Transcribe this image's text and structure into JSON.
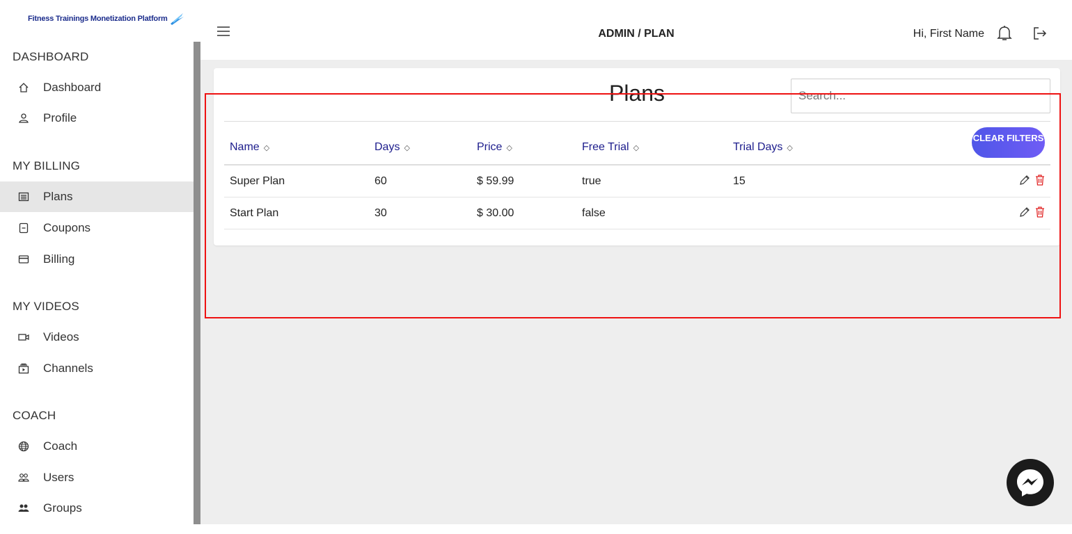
{
  "brand": {
    "name": "Fitness Trainings Monetization Platform"
  },
  "sidebar": {
    "sections": [
      {
        "title": "DASHBOARD",
        "items": [
          {
            "label": "Dashboard",
            "icon": "home-icon"
          },
          {
            "label": "Profile",
            "icon": "user-icon"
          }
        ]
      },
      {
        "title": "MY BILLING",
        "items": [
          {
            "label": "Plans",
            "icon": "list-icon",
            "active": true
          },
          {
            "label": "Coupons",
            "icon": "coupon-icon"
          },
          {
            "label": "Billing",
            "icon": "credit-card-icon"
          }
        ]
      },
      {
        "title": "MY VIDEOS",
        "items": [
          {
            "label": "Videos",
            "icon": "video-icon"
          },
          {
            "label": "Channels",
            "icon": "channels-icon"
          }
        ]
      },
      {
        "title": "COACH",
        "items": [
          {
            "label": "Coach",
            "icon": "globe-icon"
          },
          {
            "label": "Users",
            "icon": "users-icon"
          },
          {
            "label": "Groups",
            "icon": "groups-icon"
          }
        ]
      }
    ]
  },
  "header": {
    "title": "ADMIN / PLAN",
    "greeting": "Hi, First Name"
  },
  "main": {
    "title": "Plans",
    "search_placeholder": "Search...",
    "clear_filters_label": "CLEAR FILTERS",
    "columns": [
      "Name",
      "Days",
      "Price",
      "Free Trial",
      "Trial Days"
    ],
    "rows": [
      [
        "Super Plan",
        "60",
        "$ 59.99",
        "true",
        "15"
      ],
      [
        "Start Plan",
        "30",
        "$ 30.00",
        "false",
        ""
      ]
    ]
  },
  "colors": {
    "accent": "#5a56ee",
    "highlight": "#ee1111",
    "delete": "#e02424",
    "table_header": "#1c1c8c"
  }
}
